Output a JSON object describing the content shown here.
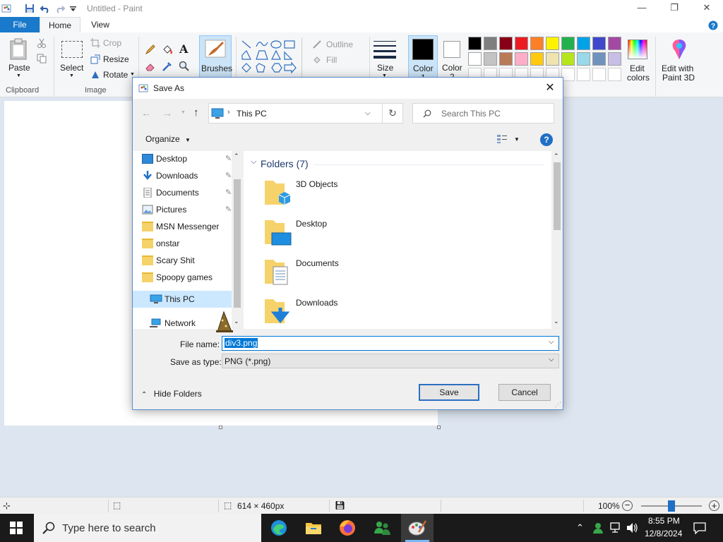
{
  "window": {
    "title": "Untitled - Paint",
    "minimize": "—",
    "maximize": "❐",
    "close": "✕"
  },
  "tabs": {
    "file": "File",
    "home": "Home",
    "view": "View"
  },
  "ribbon": {
    "clipboard": {
      "paste": "Paste",
      "group": "Clipboard"
    },
    "image": {
      "select": "Select",
      "crop": "Crop",
      "resize": "Resize",
      "rotate": "Rotate",
      "group": "Image"
    },
    "brushes": "Brushes",
    "shapes": {
      "outline": "Outline",
      "fill": "Fill"
    },
    "size": "Size",
    "color1": {
      "label": "Color",
      "num": "1"
    },
    "color2": {
      "label": "Color",
      "num": "2"
    },
    "edit_colors": [
      "Edit",
      "colors"
    ],
    "edit_3d": [
      "Edit with",
      "Paint 3D"
    ],
    "palette_row1": [
      "#000000",
      "#7f7f7f",
      "#880015",
      "#ed1c24",
      "#ff7f27",
      "#fff200",
      "#22b14c",
      "#00a2e8",
      "#3f48cc",
      "#a349a4"
    ],
    "palette_row2": [
      "#ffffff",
      "#c3c3c3",
      "#b97a57",
      "#ffaec9",
      "#ffc90e",
      "#efe4b0",
      "#b5e61d",
      "#99d9ea",
      "#7092be",
      "#c8bfe7"
    ]
  },
  "dialog": {
    "title": "Save As",
    "address": "This PC",
    "search_placeholder": "Search This PC",
    "organize": "Organize",
    "help": "?",
    "nav": [
      {
        "label": "Desktop",
        "pinned": "true"
      },
      {
        "label": "Downloads",
        "pinned": "true"
      },
      {
        "label": "Documents",
        "pinned": "true"
      },
      {
        "label": "Pictures",
        "pinned": "true"
      },
      {
        "label": "MSN Messenger"
      },
      {
        "label": "onstar"
      },
      {
        "label": "Scary Shit"
      },
      {
        "label": "Spoopy games"
      },
      {
        "label": "This PC"
      },
      {
        "label": "Network"
      }
    ],
    "folders_header": "Folders (7)",
    "folders": [
      "3D Objects",
      "Desktop",
      "Documents",
      "Downloads"
    ],
    "file_name_label": "File name:",
    "file_name_value": "div3.png",
    "save_type_label": "Save as type:",
    "save_type_value": "PNG (*.png)",
    "hide_folders": "Hide Folders",
    "save": "Save",
    "cancel": "Cancel"
  },
  "status": {
    "dimensions": "614 × 460px",
    "zoom": "100%"
  },
  "taskbar": {
    "search_placeholder": "Type here to search",
    "time": "8:55 PM",
    "date": "12/8/2024"
  }
}
